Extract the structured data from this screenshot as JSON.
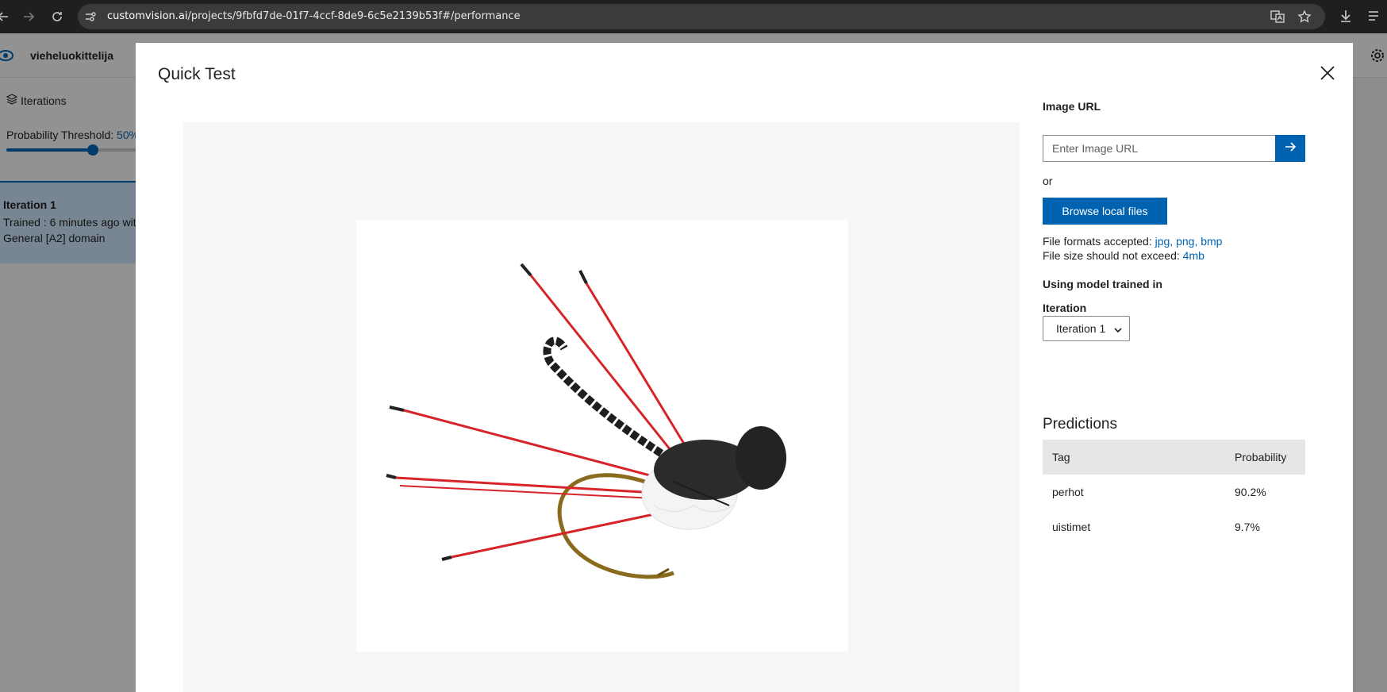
{
  "browser": {
    "url_host": "customvision.ai",
    "url_path": "/projects/9fbfd7de-01f7-4ccf-8de9-6c5e2139b53f#/performance"
  },
  "app": {
    "project_name": "vieheluokittelija"
  },
  "sidebar": {
    "iterations_label": "Iterations",
    "threshold_label": "Probability Threshold: ",
    "threshold_value": "50%",
    "threshold_fraction": 0.5,
    "iteration_card": {
      "title": "Iteration 1",
      "line1": "Trained : 6 minutes ago wit",
      "line2": "General [A2] domain"
    }
  },
  "modal": {
    "title": "Quick Test",
    "image_url_label": "Image URL",
    "image_url_placeholder": "Enter Image URL",
    "or_text": "or",
    "browse_button": "Browse local files",
    "formats_prefix": "File formats accepted: ",
    "formats_value": "jpg, png, bmp",
    "size_prefix": "File size should not exceed: ",
    "size_value": "4mb",
    "using_model_label": "Using model trained in",
    "iteration_label": "Iteration",
    "iteration_selected": "Iteration 1",
    "predictions": {
      "title": "Predictions",
      "columns": [
        "Tag",
        "Probability"
      ],
      "rows": [
        {
          "tag": "perhot",
          "probability": "90.2%"
        },
        {
          "tag": "uistimet",
          "probability": "9.7%"
        }
      ]
    }
  },
  "colors": {
    "accent": "#0063b1",
    "chrome_bg": "#1f1f1f"
  }
}
